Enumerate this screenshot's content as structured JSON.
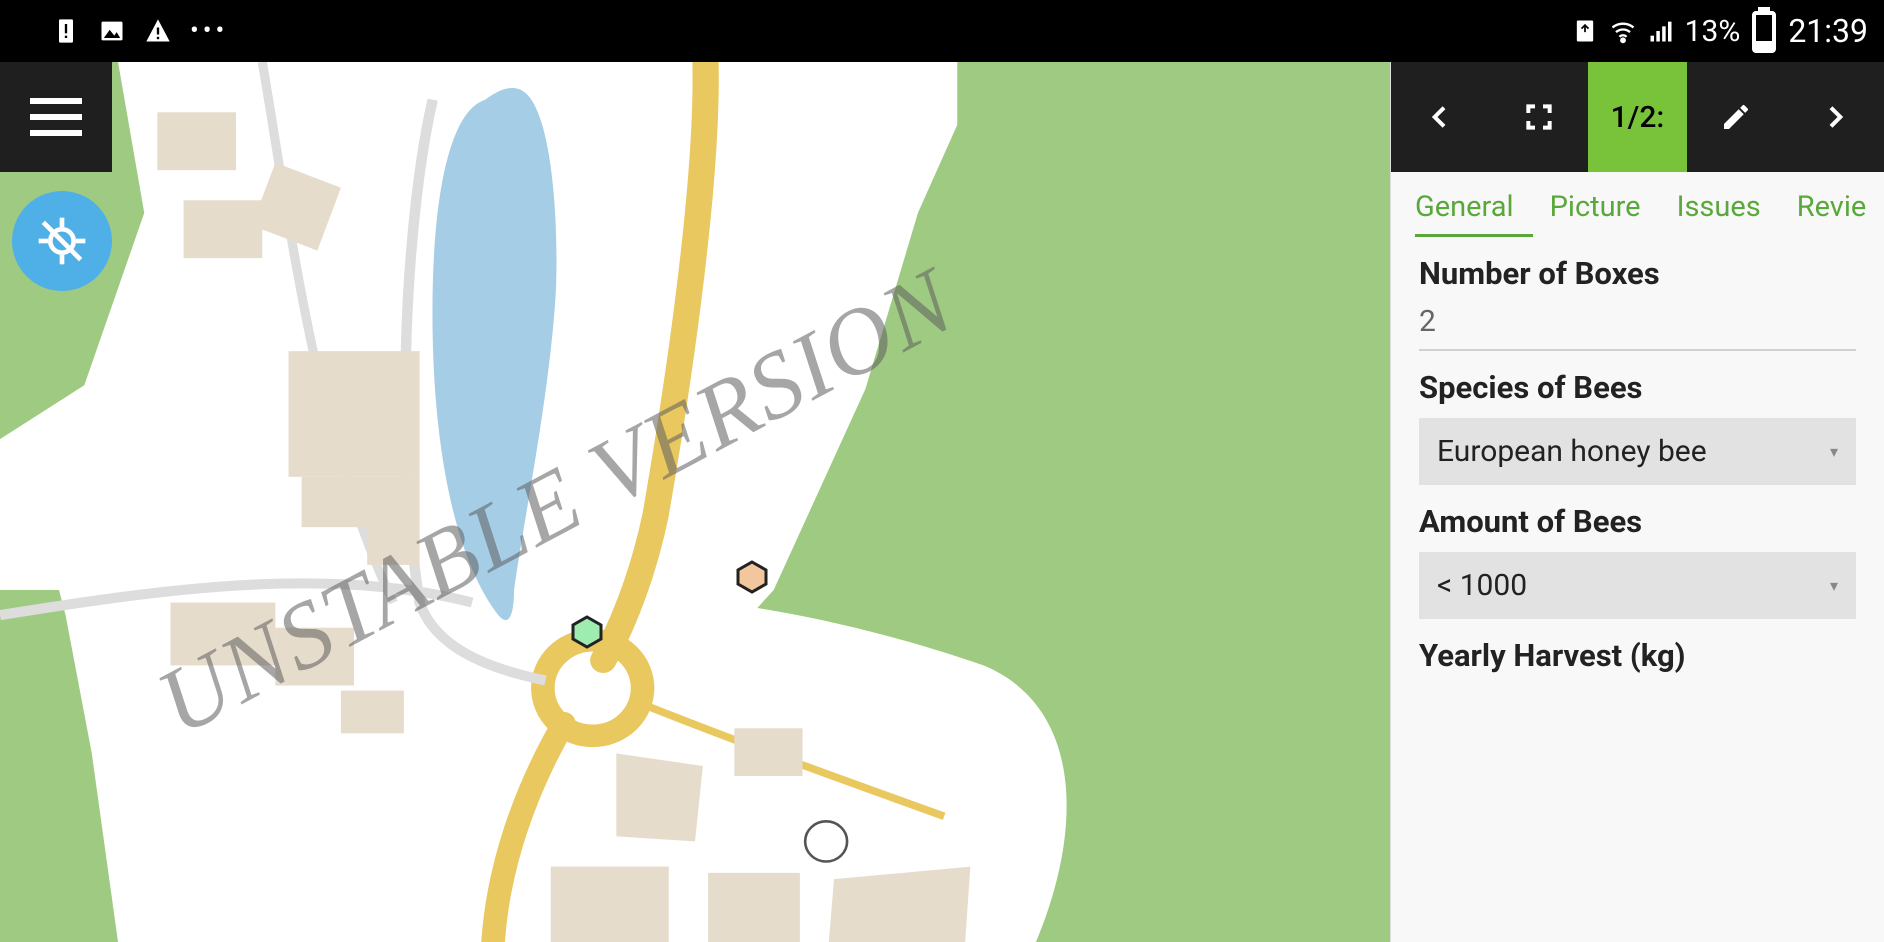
{
  "status": {
    "battery": "13%",
    "time": "21:39"
  },
  "watermark": "UNSTABLE VERSION",
  "toolbar": {
    "counter": "1/2:"
  },
  "tabs": [
    "General",
    "Picture",
    "Issues",
    "Revie"
  ],
  "form": {
    "fields": [
      {
        "label": "Number of Boxes",
        "value": "2",
        "type": "text"
      },
      {
        "label": "Species of Bees",
        "value": "European honey bee",
        "type": "select"
      },
      {
        "label": "Amount of Bees",
        "value": "< 1000",
        "type": "select"
      },
      {
        "label": "Yearly Harvest (kg)",
        "value": "",
        "type": "text"
      }
    ]
  }
}
